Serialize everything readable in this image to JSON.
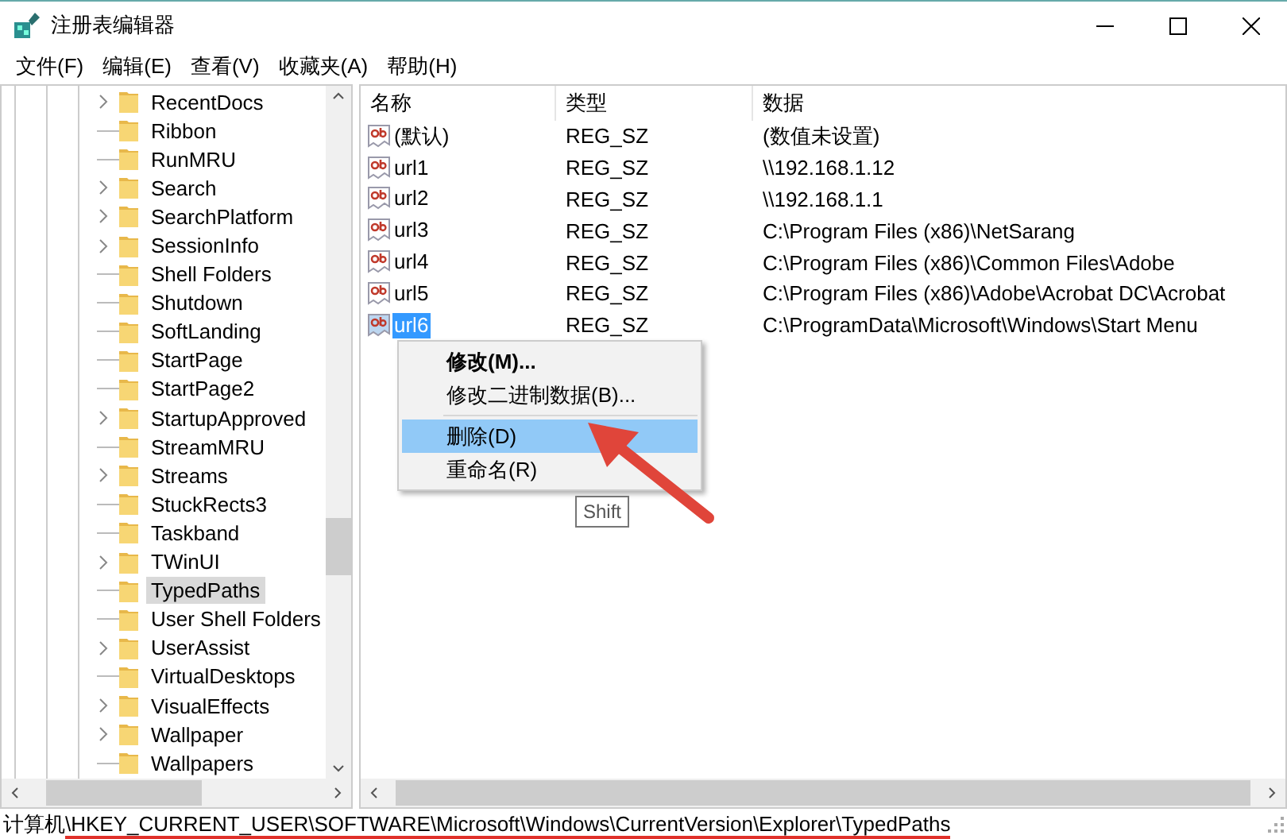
{
  "window": {
    "title": "注册表编辑器"
  },
  "menu": [
    "文件(F)",
    "编辑(E)",
    "查看(V)",
    "收藏夹(A)",
    "帮助(H)"
  ],
  "tree": {
    "items": [
      {
        "label": "RecentDocs",
        "expandable": true,
        "selected": false
      },
      {
        "label": "Ribbon",
        "expandable": false,
        "selected": false
      },
      {
        "label": "RunMRU",
        "expandable": false,
        "selected": false
      },
      {
        "label": "Search",
        "expandable": true,
        "selected": false
      },
      {
        "label": "SearchPlatform",
        "expandable": true,
        "selected": false
      },
      {
        "label": "SessionInfo",
        "expandable": true,
        "selected": false
      },
      {
        "label": "Shell Folders",
        "expandable": false,
        "selected": false
      },
      {
        "label": "Shutdown",
        "expandable": false,
        "selected": false
      },
      {
        "label": "SoftLanding",
        "expandable": false,
        "selected": false
      },
      {
        "label": "StartPage",
        "expandable": false,
        "selected": false
      },
      {
        "label": "StartPage2",
        "expandable": false,
        "selected": false
      },
      {
        "label": "StartupApproved",
        "expandable": true,
        "selected": false
      },
      {
        "label": "StreamMRU",
        "expandable": false,
        "selected": false
      },
      {
        "label": "Streams",
        "expandable": true,
        "selected": false
      },
      {
        "label": "StuckRects3",
        "expandable": false,
        "selected": false
      },
      {
        "label": "Taskband",
        "expandable": false,
        "selected": false
      },
      {
        "label": "TWinUI",
        "expandable": true,
        "selected": false
      },
      {
        "label": "TypedPaths",
        "expandable": false,
        "selected": true
      },
      {
        "label": "User Shell Folders",
        "expandable": false,
        "selected": false
      },
      {
        "label": "UserAssist",
        "expandable": true,
        "selected": false
      },
      {
        "label": "VirtualDesktops",
        "expandable": false,
        "selected": false
      },
      {
        "label": "VisualEffects",
        "expandable": true,
        "selected": false
      },
      {
        "label": "Wallpaper",
        "expandable": true,
        "selected": false
      },
      {
        "label": "Wallpapers",
        "expandable": false,
        "selected": false
      }
    ]
  },
  "table": {
    "columns": [
      "名称",
      "类型",
      "数据"
    ],
    "rows": [
      {
        "name": "(默认)",
        "type": "REG_SZ",
        "data": "(数值未设置)",
        "selected": false
      },
      {
        "name": "url1",
        "type": "REG_SZ",
        "data": "\\\\192.168.1.12",
        "selected": false
      },
      {
        "name": "url2",
        "type": "REG_SZ",
        "data": "\\\\192.168.1.1",
        "selected": false
      },
      {
        "name": "url3",
        "type": "REG_SZ",
        "data": "C:\\Program Files (x86)\\NetSarang",
        "selected": false
      },
      {
        "name": "url4",
        "type": "REG_SZ",
        "data": "C:\\Program Files (x86)\\Common Files\\Adobe",
        "selected": false
      },
      {
        "name": "url5",
        "type": "REG_SZ",
        "data": "C:\\Program Files (x86)\\Adobe\\Acrobat DC\\Acrobat",
        "selected": false
      },
      {
        "name": "url6",
        "type": "REG_SZ",
        "data": "C:\\ProgramData\\Microsoft\\Windows\\Start Menu",
        "selected": true
      }
    ]
  },
  "context_menu": {
    "items": [
      {
        "kind": "item",
        "label": "修改(M)...",
        "default": true,
        "selected": false
      },
      {
        "kind": "item",
        "label": "修改二进制数据(B)...",
        "default": false,
        "selected": false
      },
      {
        "kind": "separator"
      },
      {
        "kind": "item",
        "label": "删除(D)",
        "default": false,
        "selected": true
      },
      {
        "kind": "item",
        "label": "重命名(R)",
        "default": false,
        "selected": false
      }
    ]
  },
  "tooltip": "Shift",
  "status_bar": {
    "prefix": "计算机",
    "path": "\\HKEY_CURRENT_USER\\SOFTWARE\\Microsoft\\Windows\\CurrentVersion\\Explorer\\TypedPaths",
    "underlined": true
  }
}
